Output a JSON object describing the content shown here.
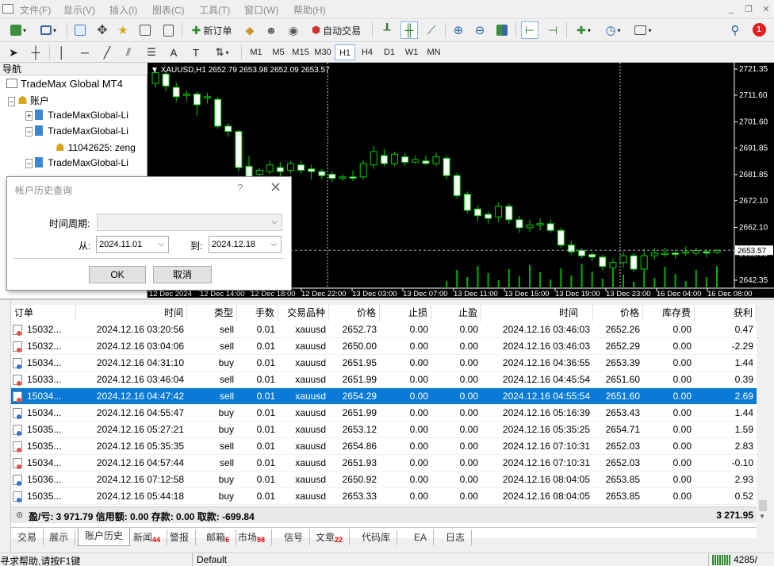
{
  "menu": [
    "文件(F)",
    "显示(V)",
    "插入(I)",
    "图表(C)",
    "工具(T)",
    "窗口(W)",
    "帮助(H)"
  ],
  "toolbar": {
    "new_order": "新订单",
    "auto_trade": "自动交易",
    "timeframes": [
      "M1",
      "M5",
      "M15",
      "M30",
      "H1",
      "H4",
      "D1",
      "W1",
      "MN"
    ],
    "active_timeframe": "H1",
    "notification_count": "1"
  },
  "navigator": {
    "title": "导航",
    "root": "TradeMax Global MT4",
    "accounts_label": "账户",
    "items": [
      "TradeMaxGlobal-Li",
      "TradeMaxGlobal-Li",
      "11042625: zeng",
      "TradeMaxGlobal-Li"
    ]
  },
  "chart": {
    "header": "XAUUSD,H1  2652.79 2653.98 2652.09 2653.57",
    "current_price": "2653.57",
    "price_labels": [
      "2721.35",
      "2711.60",
      "2701.60",
      "2691.85",
      "2681.85",
      "2672.10",
      "2662.10",
      "2652.35",
      "2642.35"
    ],
    "time_labels": [
      "12 Dec 2024",
      "12 Dec 14:00",
      "12 Dec 18:00",
      "12 Dec 22:00",
      "13 Dec 03:00",
      "13 Dec 07:00",
      "13 Dec 11:00",
      "13 Dec 15:00",
      "13 Dec 19:00",
      "13 Dec 23:00",
      "16 Dec 04:00",
      "16 Dec 08:00"
    ],
    "colors": {
      "bull": "#000000",
      "bear": "#ffffff",
      "wick": "#00d000",
      "volume": "#00c000"
    }
  },
  "dialog": {
    "title": "帐户历史查询",
    "help": "?",
    "period_label": "时间周期:",
    "period_value": "",
    "from_label": "从:",
    "from_value": "2024.11.01",
    "to_label": "到:",
    "to_value": "2024.12.18",
    "ok": "OK",
    "cancel": "取消"
  },
  "table": {
    "headers": [
      "订单",
      "时间",
      "类型",
      "手数",
      "交易品种",
      "价格",
      "止损",
      "止盈",
      "时间",
      "价格",
      "库存费",
      "获利"
    ],
    "rows": [
      [
        "15032...",
        "2024.12.16 03:20:56",
        "sell",
        "0.01",
        "xauusd",
        "2652.73",
        "0.00",
        "0.00",
        "2024.12.16 03:46:03",
        "2652.26",
        "0.00",
        "0.47"
      ],
      [
        "15032...",
        "2024.12.16 03:04:06",
        "sell",
        "0.01",
        "xauusd",
        "2650.00",
        "0.00",
        "0.00",
        "2024.12.16 03:46:03",
        "2652.29",
        "0.00",
        "-2.29"
      ],
      [
        "15034...",
        "2024.12.16 04:31:10",
        "buy",
        "0.01",
        "xauusd",
        "2651.95",
        "0.00",
        "0.00",
        "2024.12.16 04:36:55",
        "2653.39",
        "0.00",
        "1.44"
      ],
      [
        "15033...",
        "2024.12.16 03:46:04",
        "sell",
        "0.01",
        "xauusd",
        "2651.99",
        "0.00",
        "0.00",
        "2024.12.16 04:45:54",
        "2651.60",
        "0.00",
        "0.39"
      ],
      [
        "15034...",
        "2024.12.16 04:47:42",
        "sell",
        "0.01",
        "xauusd",
        "2654.29",
        "0.00",
        "0.00",
        "2024.12.16 04:55:54",
        "2651.60",
        "0.00",
        "2.69"
      ],
      [
        "15034...",
        "2024.12.16 04:55:47",
        "buy",
        "0.01",
        "xauusd",
        "2651.99",
        "0.00",
        "0.00",
        "2024.12.16 05:16:39",
        "2653.43",
        "0.00",
        "1.44"
      ],
      [
        "15035...",
        "2024.12.16 05:27:21",
        "buy",
        "0.01",
        "xauusd",
        "2653.12",
        "0.00",
        "0.00",
        "2024.12.16 05:35:25",
        "2654.71",
        "0.00",
        "1.59"
      ],
      [
        "15035...",
        "2024.12.16 05:35:35",
        "sell",
        "0.01",
        "xauusd",
        "2654.86",
        "0.00",
        "0.00",
        "2024.12.16 07:10:31",
        "2652.03",
        "0.00",
        "2.83"
      ],
      [
        "15034...",
        "2024.12.16 04:57:44",
        "sell",
        "0.01",
        "xauusd",
        "2651.93",
        "0.00",
        "0.00",
        "2024.12.16 07:10:31",
        "2652.03",
        "0.00",
        "-0.10"
      ],
      [
        "15036...",
        "2024.12.16 07:12:58",
        "buy",
        "0.01",
        "xauusd",
        "2650.92",
        "0.00",
        "0.00",
        "2024.12.16 08:04:05",
        "2653.85",
        "0.00",
        "2.93"
      ],
      [
        "15035...",
        "2024.12.16 05:44:18",
        "buy",
        "0.01",
        "xauusd",
        "2653.33",
        "0.00",
        "0.00",
        "2024.12.16 08:04:05",
        "2653.85",
        "0.00",
        "0.52"
      ]
    ],
    "selected_row": 4,
    "summary_text": "盈/亏: 3 971.79  信用额: 0.00  存款: 0.00  取款: -699.84",
    "summary_total": "3 271.95"
  },
  "tabs": [
    {
      "label": "交易",
      "badge": ""
    },
    {
      "label": "展示",
      "badge": ""
    },
    {
      "label": "账户历史",
      "badge": ""
    },
    {
      "label": "新闻",
      "badge": "44"
    },
    {
      "label": "警报",
      "badge": ""
    },
    {
      "label": "邮箱",
      "badge": "6"
    },
    {
      "label": "市场",
      "badge": "98"
    },
    {
      "label": "信号",
      "badge": ""
    },
    {
      "label": "文章",
      "badge": "22"
    },
    {
      "label": "代码库",
      "badge": ""
    },
    {
      "label": "EA",
      "badge": ""
    },
    {
      "label": "日志",
      "badge": ""
    }
  ],
  "active_tab": "账户历史",
  "status": {
    "help": "寻求帮助,请按F1键",
    "profile": "Default",
    "traffic": "4285/"
  }
}
